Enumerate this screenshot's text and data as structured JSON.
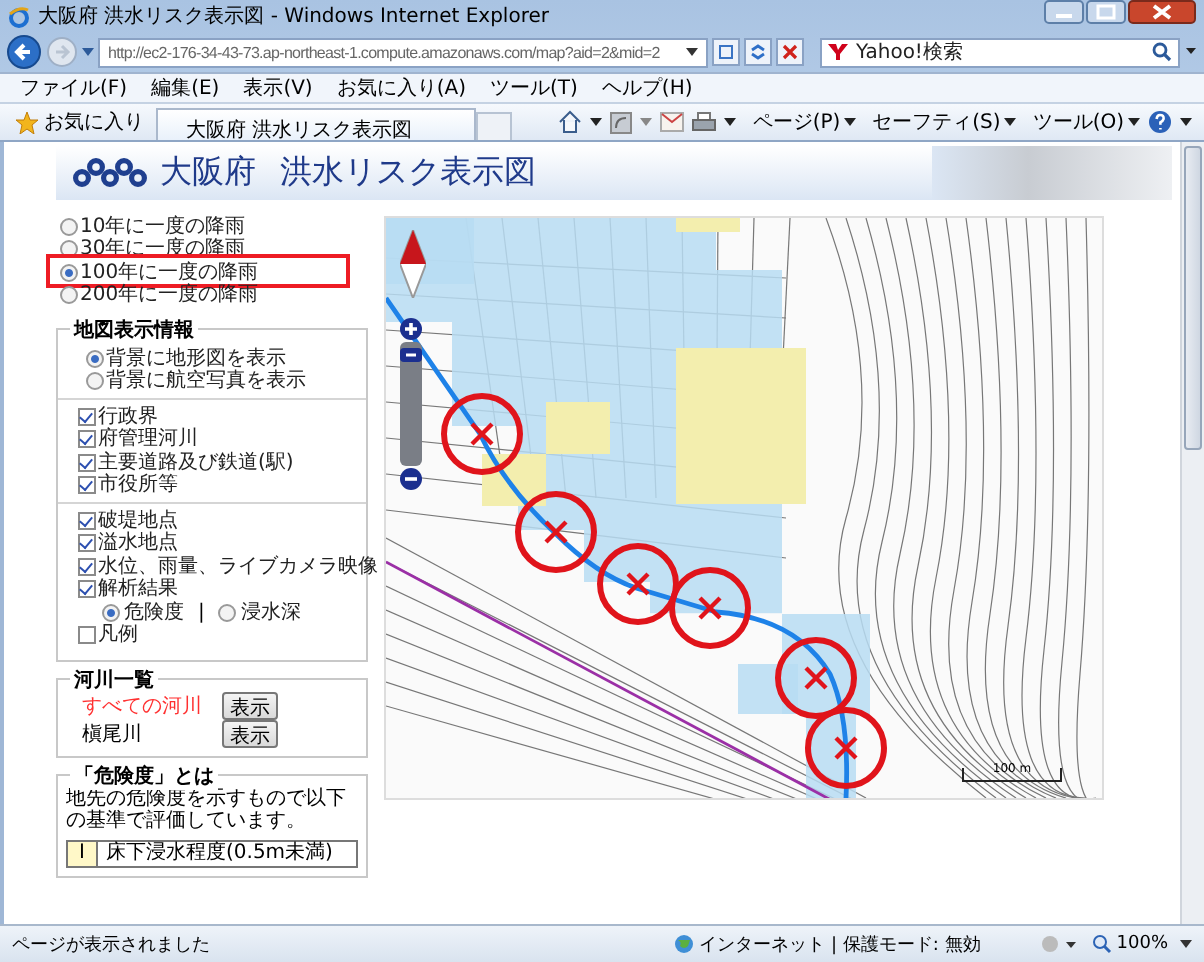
{
  "window": {
    "title": "大阪府 洪水リスク表示図 - Windows Internet Explorer"
  },
  "address_bar": {
    "url": "http://ec2-176-34-43-73.ap-northeast-1.compute.amazonaws.com/map?aid=2&mid=2"
  },
  "search": {
    "placeholder": "Yahoo!検索"
  },
  "menu": [
    "ファイル(F)",
    "編集(E)",
    "表示(V)",
    "お気に入り(A)",
    "ツール(T)",
    "ヘルプ(H)"
  ],
  "favorites_button": "お気に入り",
  "tabs": [
    {
      "label": "大阪府 洪水リスク表示図",
      "selected": true
    }
  ],
  "command_bar": [
    "ページ(P)",
    "セーフティ(S)",
    "ツール(O)"
  ],
  "page": {
    "header": {
      "prefecture": "大阪府",
      "title": "洪水リスク表示図"
    },
    "rainfall_options": [
      {
        "label": "10年に一度の降雨",
        "selected": false
      },
      {
        "label": "30年に一度の降雨",
        "selected": false
      },
      {
        "label": "100年に一度の降雨",
        "selected": true,
        "highlighted": true
      },
      {
        "label": "200年に一度の降雨",
        "selected": false
      }
    ],
    "map_info": {
      "title": "地図表示情報",
      "background_options": [
        {
          "label": "背景に地形図を表示",
          "selected": true
        },
        {
          "label": "背景に航空写真を表示",
          "selected": false
        }
      ],
      "layer_groups": [
        [
          {
            "label": "行政界",
            "checked": true
          },
          {
            "label": "府管理河川",
            "checked": true
          },
          {
            "label": "主要道路及び鉄道(駅)",
            "checked": true
          },
          {
            "label": "市役所等",
            "checked": true
          }
        ],
        [
          {
            "label": "破堤地点",
            "checked": true
          },
          {
            "label": "溢水地点",
            "checked": true
          },
          {
            "label": "水位、雨量、ライブカメラ映像",
            "checked": true
          },
          {
            "label": "解析結果",
            "checked": true,
            "options": [
              {
                "label": "危険度",
                "selected": true
              },
              {
                "label": "浸水深",
                "selected": false
              }
            ],
            "separator": "|"
          },
          {
            "label": "凡例",
            "checked": false
          }
        ]
      ]
    },
    "rivers": {
      "title": "河川一覧",
      "items": [
        {
          "name": "すべての河川",
          "highlighted": true,
          "button": "表示"
        },
        {
          "name": "槇尾川",
          "highlighted": false,
          "button": "表示"
        }
      ]
    },
    "hazard_info": {
      "title": "「危険度」とは",
      "description": "地先の危険度を示すもので以下の基準で評価しています。",
      "levels": [
        {
          "grade": "I",
          "description": "床下浸水程度(0.5m未満)"
        }
      ]
    },
    "map": {
      "scale": "100 m",
      "zoom_slider": {
        "level": 0.95
      }
    }
  },
  "status_bar": {
    "message": "ページが表示されました",
    "zone": "インターネット | 保護モード: 無効",
    "zoom": "100%"
  }
}
